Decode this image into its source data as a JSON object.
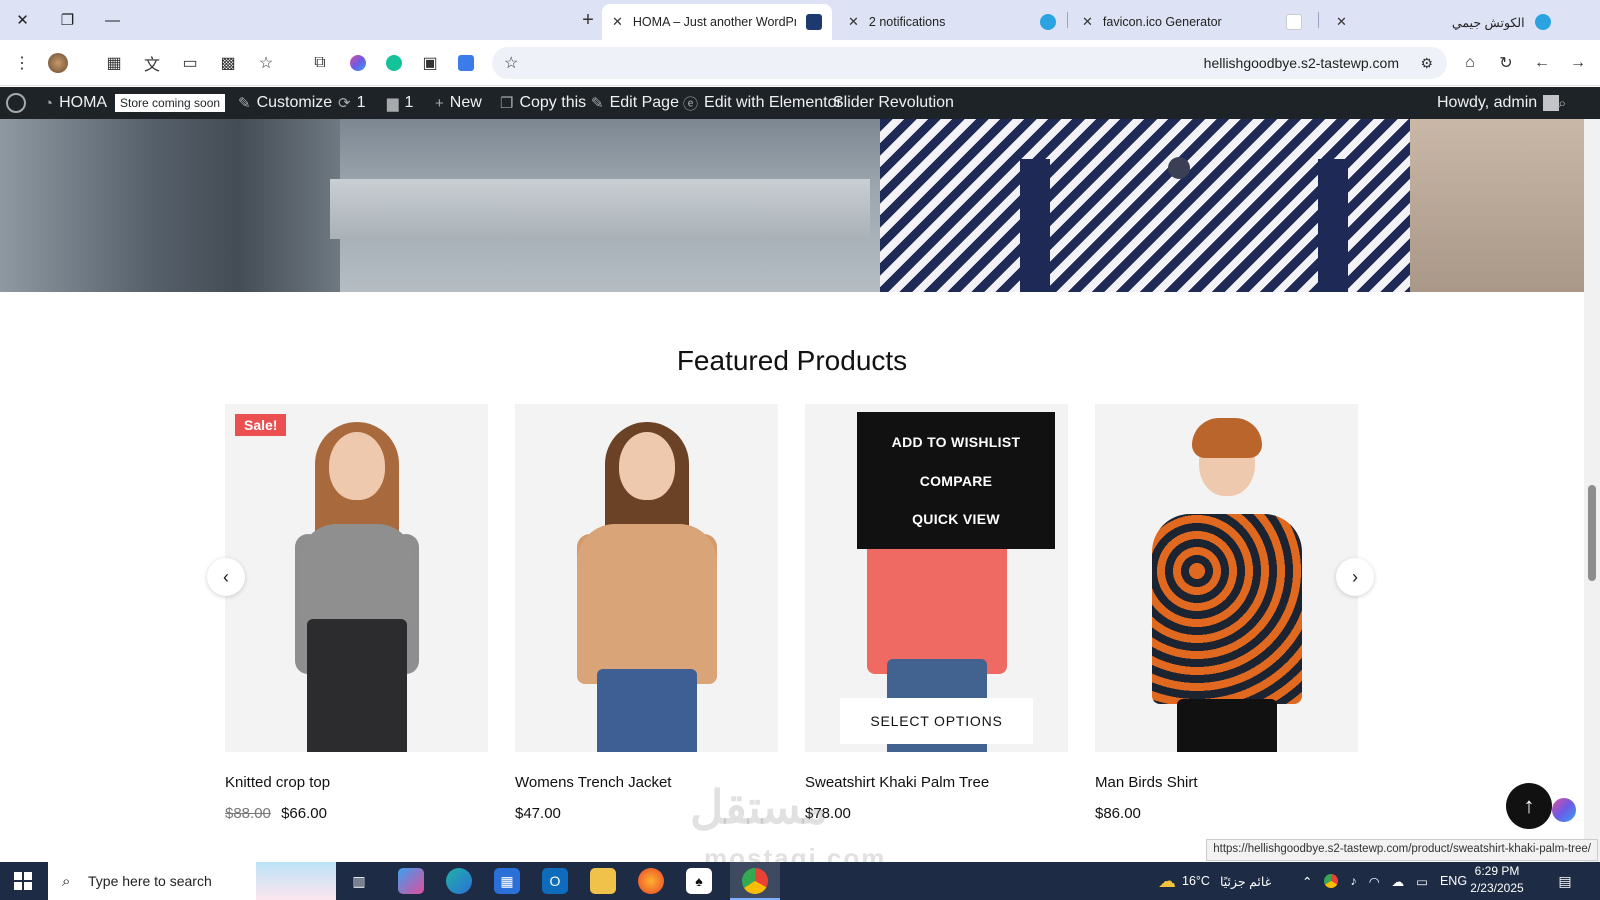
{
  "tabs": [
    {
      "title": "HOMA – Just another WordPress",
      "active": true,
      "favicon_color": "#1d3a6e"
    },
    {
      "title": "2 notifications",
      "active": false,
      "favicon_color": "#2aa3e0"
    },
    {
      "title": "favicon.ico Generator",
      "active": false,
      "favicon_color": "#e44"
    },
    {
      "title": "الكوتش جيمي",
      "active": false,
      "favicon_color": "#2aa3e0"
    }
  ],
  "window": {
    "close": "✕",
    "restore": "❐",
    "minimize": "—",
    "new_tab": "+"
  },
  "toolbar": {
    "url": "hellishgoodbye.s2-tastewp.com",
    "icons": [
      "menu-dots-icon",
      "profile-avatar-icon",
      "table-icon",
      "translate-icon",
      "devices-icon",
      "qr-icon",
      "bookmark-star-icon",
      "extensions-icon",
      "copilot-icon",
      "grammarly-icon",
      "image-ext-icon",
      "translate-ext-icon"
    ]
  },
  "wpbar": {
    "site_name": "HOMA",
    "store_badge": "Store coming soon",
    "customize": "Customize",
    "updates_count": "1",
    "comments_count": "1",
    "new": "New",
    "copy_this": "Copy this",
    "edit_page": "Edit Page",
    "edit_elementor": "Edit with Elementor",
    "slider_revolution": "Slider Revolution",
    "howdy": "Howdy, admin"
  },
  "featured": {
    "title": "Featured Products",
    "products": [
      {
        "name": "Knitted crop top",
        "old_price": "$88.00",
        "price": "$66.00",
        "badge": "Sale!"
      },
      {
        "name": "Womens Trench Jacket",
        "old_price": "",
        "price": "$47.00",
        "badge": ""
      },
      {
        "name": "Sweatshirt Khaki Palm Tree",
        "old_price": "",
        "price": "$78.00",
        "badge": ""
      },
      {
        "name": "Man Birds Shirt",
        "old_price": "",
        "price": "$86.00",
        "badge": ""
      }
    ],
    "hover_menu": {
      "wishlist": "ADD TO WISHLIST",
      "compare": "COMPARE",
      "quick_view": "QUICK VIEW"
    },
    "select_options": "SELECT OPTIONS",
    "prev": "‹",
    "next": "›"
  },
  "status_url": "https://hellishgoodbye.s2-tastewp.com/product/sweatshirt-khaki-palm-tree/",
  "watermark": {
    "arabic": "مستقل",
    "latin": "mostaqi.com"
  },
  "taskbar": {
    "search_placeholder": "Type here to search",
    "weather_temp": "16°C",
    "weather_desc": "غائم جزئيًا",
    "language": "ENG",
    "time": "6:29 PM",
    "date": "2/23/2025"
  }
}
